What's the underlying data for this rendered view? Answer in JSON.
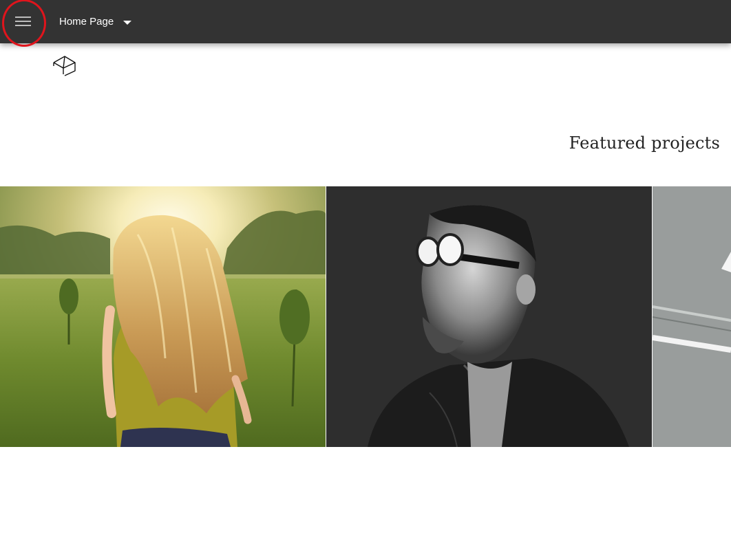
{
  "header": {
    "menu_icon": "hamburger-menu-icon",
    "page_selector": {
      "selected": "Home Page",
      "icon": "caret-down-icon"
    },
    "highlight_color": "#e0141c",
    "background": "#333333"
  },
  "logo": {
    "icon": "brand-logo-icon"
  },
  "featured": {
    "title": "Featured projects",
    "projects": [
      {
        "image": "woman-in-sunlit-field-photo"
      },
      {
        "image": "man-with-goggles-bw-photo"
      },
      {
        "image": "road-markings-photo"
      }
    ]
  }
}
